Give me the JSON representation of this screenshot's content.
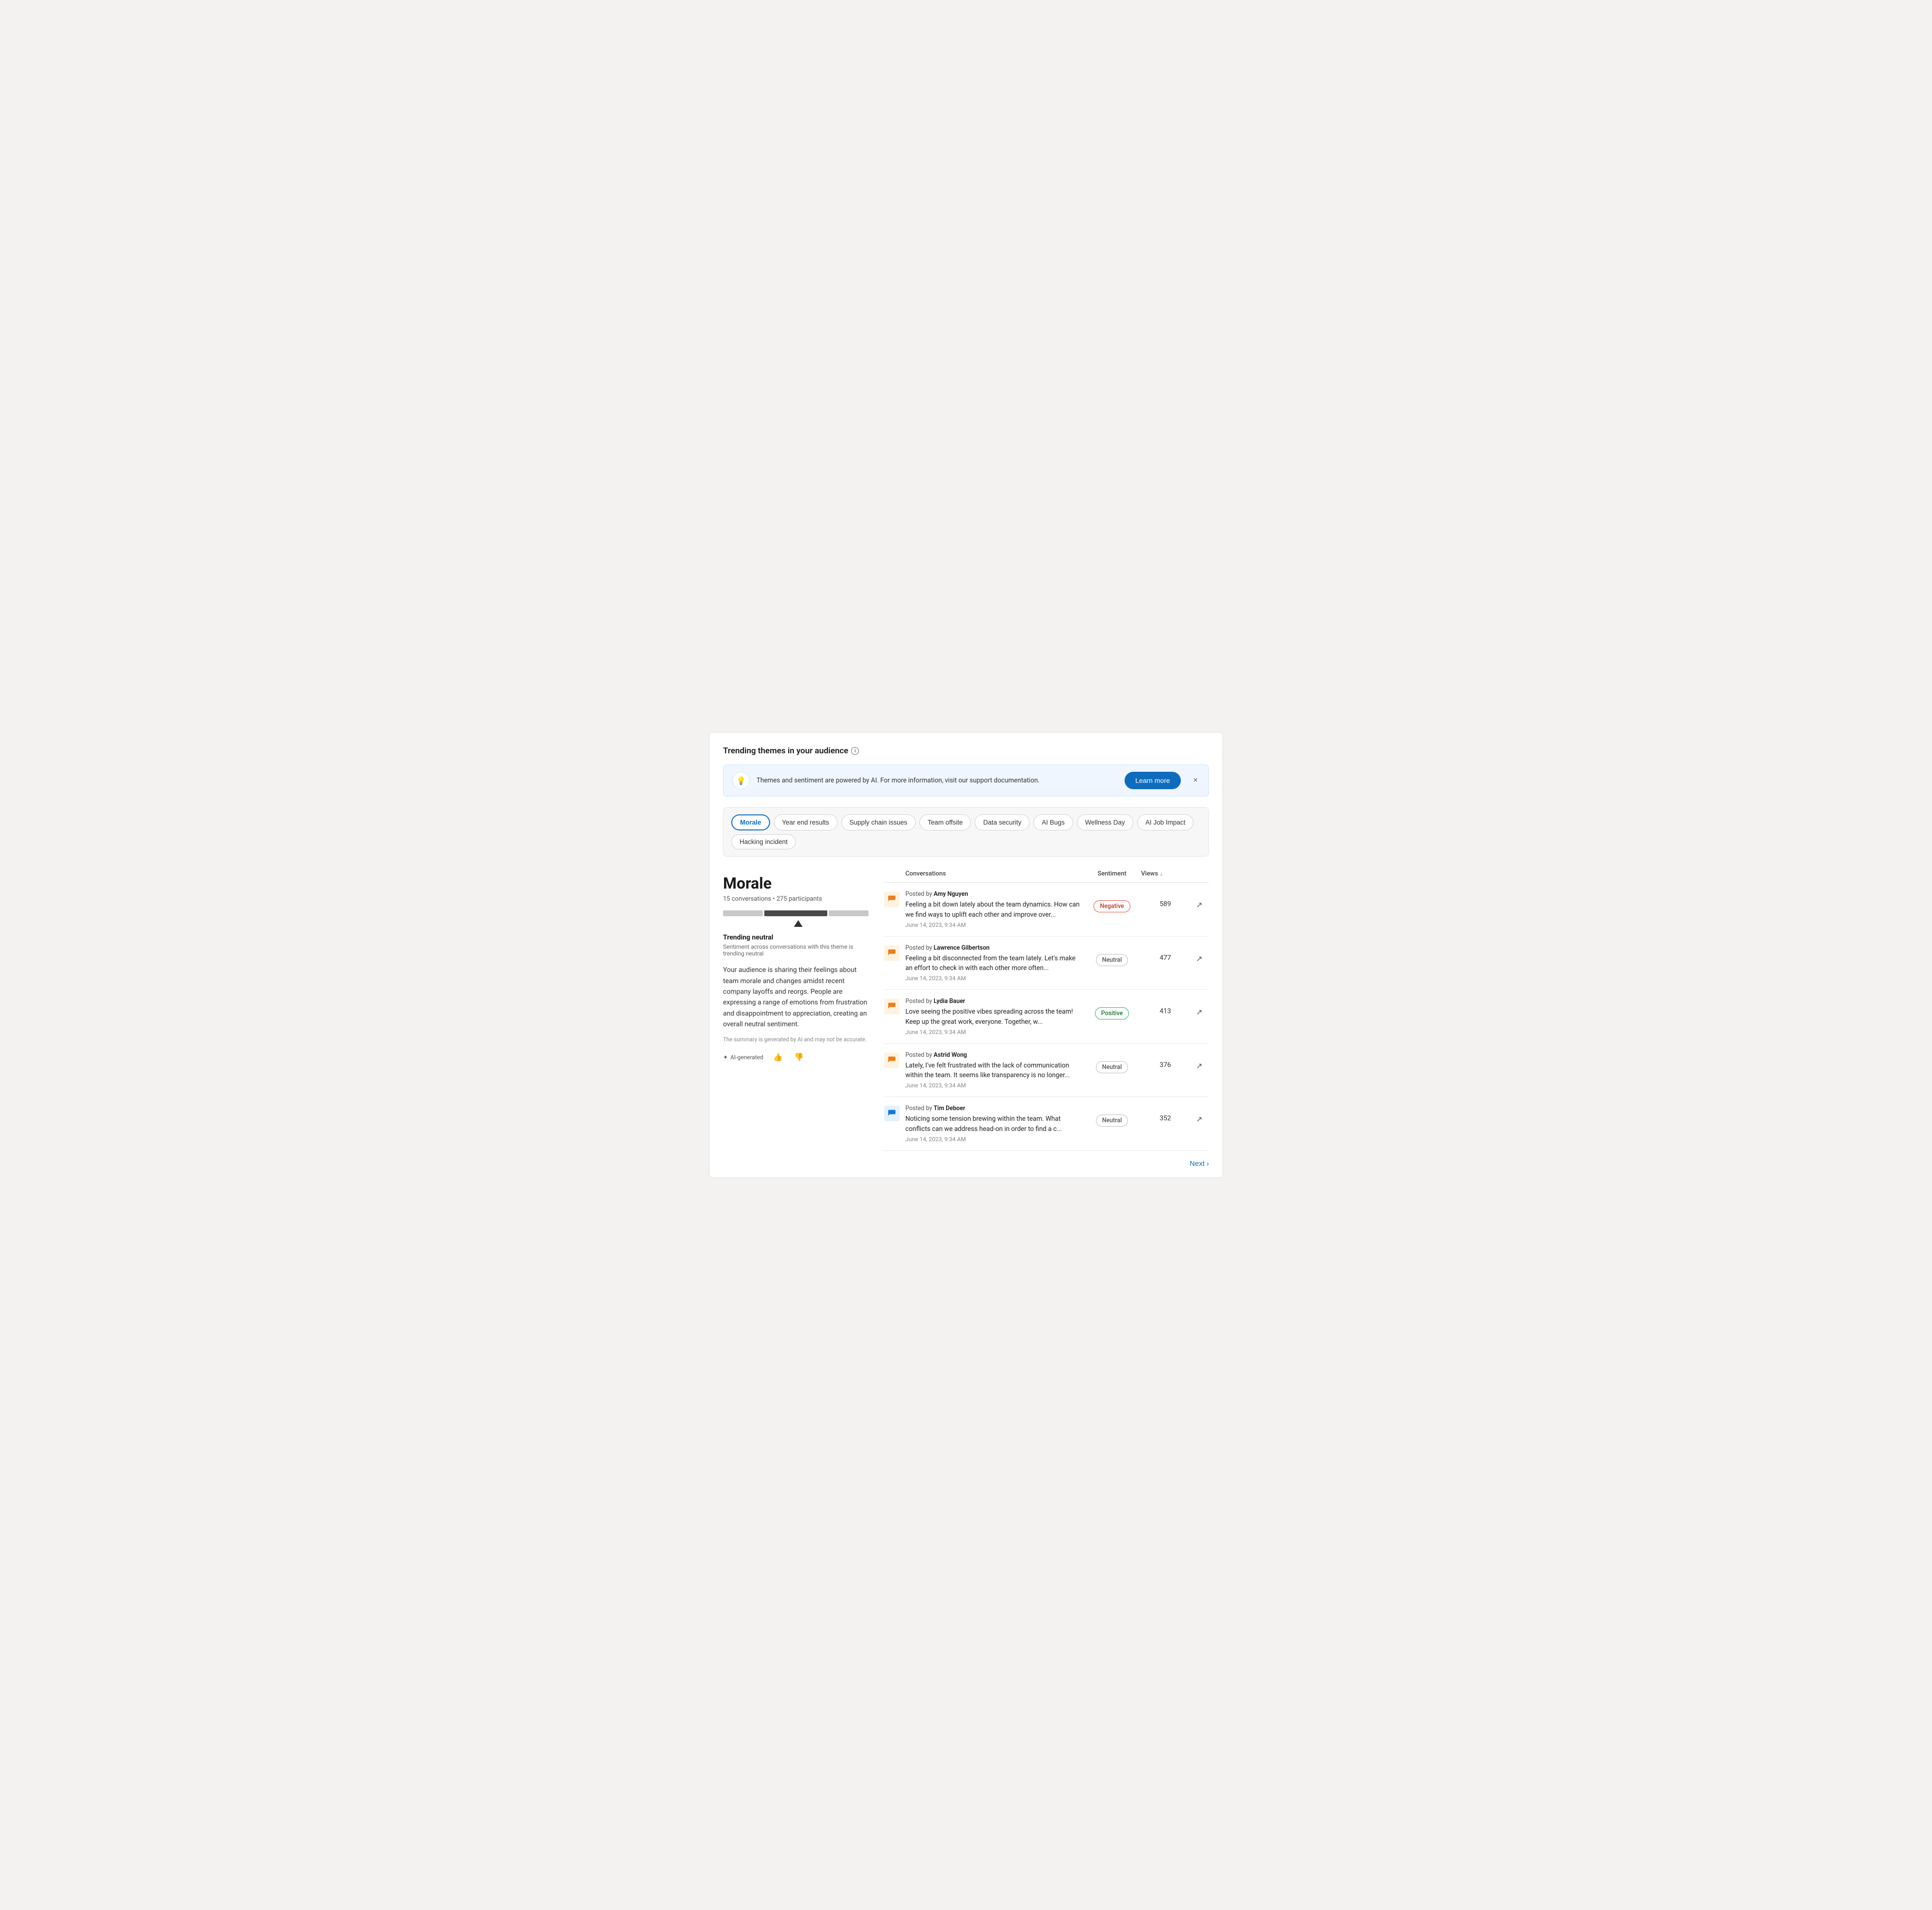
{
  "page": {
    "title": "Trending themes in your audience",
    "info_tooltip": "i"
  },
  "banner": {
    "text": "Themes and sentiment are powered by AI. For more information, visit our support documentation.",
    "learn_more_label": "Learn more",
    "close_label": "×"
  },
  "themes": {
    "items": [
      {
        "id": "morale",
        "label": "Morale",
        "active": true
      },
      {
        "id": "year-end",
        "label": "Year end results",
        "active": false
      },
      {
        "id": "supply-chain",
        "label": "Supply chain issues",
        "active": false
      },
      {
        "id": "team-offsite",
        "label": "Team offsite",
        "active": false
      },
      {
        "id": "data-security",
        "label": "Data security",
        "active": false
      },
      {
        "id": "ai-bugs",
        "label": "AI Bugs",
        "active": false
      },
      {
        "id": "wellness-day",
        "label": "Wellness Day",
        "active": false
      },
      {
        "id": "ai-job-impact",
        "label": "AI Job Impact",
        "active": false
      },
      {
        "id": "hacking-incident",
        "label": "Hacking incident",
        "active": false
      }
    ]
  },
  "detail": {
    "title": "Morale",
    "conversations_count": "15 conversations",
    "participants_count": "275 participants",
    "sentiment_bars": {
      "negative_pct": 28,
      "neutral_pct": 44,
      "positive_pct": 28
    },
    "trending_label": "Trending neutral",
    "trending_sub": "Sentiment across conversations with this theme is trending neutral",
    "description": "Your audience is sharing their feelings about team morale and changes amidst recent company layoffs and reorgs. People are expressing a range of emotions from frustration and disappointment to appreciation, creating an overall neutral sentiment.",
    "disclaimer": "The summary is generated by AI and may not be accurate.",
    "ai_generated_label": "AI-generated",
    "thumbup_label": "👍",
    "thumbdown_label": "👎"
  },
  "table": {
    "col_conversations": "Conversations",
    "col_sentiment": "Sentiment",
    "col_views": "Views",
    "conversations": [
      {
        "author": "Amy Nguyen",
        "text": "Feeling a bit down lately about the team dynamics. How can we find ways to uplift each other and improve over...",
        "date": "June 14, 2023, 9:34 AM",
        "sentiment": "Negative",
        "sentiment_type": "negative",
        "views": "589",
        "icon_color": "orange"
      },
      {
        "author": "Lawrence Gilbertson",
        "text": "Feeling a bit disconnected from the team lately. Let's make an effort to check in with each other more often...",
        "date": "June 14, 2023, 9:34 AM",
        "sentiment": "Neutral",
        "sentiment_type": "neutral",
        "views": "477",
        "icon_color": "orange"
      },
      {
        "author": "Lydia Bauer",
        "text": "Love seeing the positive vibes spreading across the team! Keep up the great work, everyone. Together, w...",
        "date": "June 14, 2023, 9:34 AM",
        "sentiment": "Positive",
        "sentiment_type": "positive",
        "views": "413",
        "icon_color": "orange"
      },
      {
        "author": "Astrid Wong",
        "text": "Lately, I've felt frustrated with the lack of communication within the team. It seems like transparency is no longer...",
        "date": "June 14, 2023, 9:34 AM",
        "sentiment": "Neutral",
        "sentiment_type": "neutral",
        "views": "376",
        "icon_color": "orange"
      },
      {
        "author": "Tim Deboer",
        "text": "Noticing some tension brewing within the team. What conflicts can we address head-on in order to find a c...",
        "date": "June 14, 2023, 9:34 AM",
        "sentiment": "Neutral",
        "sentiment_type": "neutral",
        "views": "352",
        "icon_color": "blue"
      }
    ]
  },
  "pagination": {
    "next_label": "Next"
  },
  "icons": {
    "chat_orange": "💬",
    "chat_blue": "💬",
    "trend": "↗",
    "chevron_right": "›",
    "sort_down": "↓",
    "sparkle": "✦",
    "lightbulb": "💡"
  }
}
